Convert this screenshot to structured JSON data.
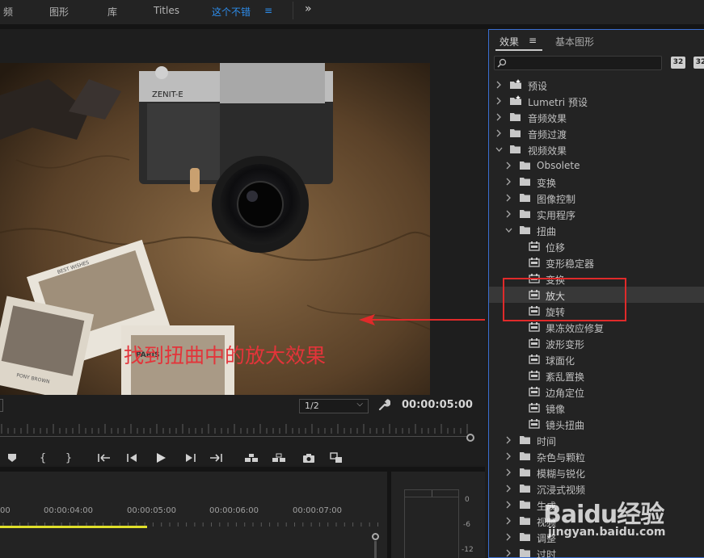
{
  "topbar": {
    "tabs": [
      {
        "label": "频",
        "active": false
      },
      {
        "label": "图形",
        "active": false
      },
      {
        "label": "库",
        "active": false
      },
      {
        "label": "Titles",
        "active": false
      },
      {
        "label": "这个不错",
        "active": true
      }
    ],
    "active_menu_icon": "hamburger-menu-icon",
    "overflow_label": "»"
  },
  "monitor": {
    "annotation_text": "找到扭曲中的放大效果",
    "resolution": "1/2",
    "timecode": "00:00:05:00",
    "camera_brand_label": "ZENIT-E",
    "photo_labels": [
      "PARIS",
      "BEST WISHES",
      "PONY BROWN"
    ],
    "transport_icons": [
      "marker-icon",
      "mark-in-icon",
      "mark-out-icon",
      "go-to-in-icon",
      "step-back-icon",
      "play-icon",
      "step-forward-icon",
      "go-to-out-icon",
      "lift-icon",
      "extract-icon",
      "export-frame-icon",
      "compare-icon"
    ],
    "add_label": "+"
  },
  "timeline": {
    "times": [
      "00",
      "00:00:04:00",
      "00:00:05:00",
      "00:00:06:00",
      "00:00:07:00"
    ],
    "meter_db": [
      "0",
      "-6",
      "-12"
    ]
  },
  "effects": {
    "tab_effects": "效果",
    "tab_menu": "≡",
    "tab_graphics": "基本图形",
    "search_value": "",
    "tool_labels": [
      "32",
      "32"
    ],
    "tree": [
      {
        "label": "预设",
        "level": 0,
        "kind": "star-folder",
        "expanded": false
      },
      {
        "label": "Lumetri 预设",
        "level": 0,
        "kind": "star-folder",
        "expanded": false
      },
      {
        "label": "音频效果",
        "level": 0,
        "kind": "folder",
        "expanded": false
      },
      {
        "label": "音频过渡",
        "level": 0,
        "kind": "folder",
        "expanded": false
      },
      {
        "label": "视频效果",
        "level": 0,
        "kind": "folder",
        "expanded": true
      },
      {
        "label": "Obsolete",
        "level": 1,
        "kind": "folder",
        "expanded": false
      },
      {
        "label": "变换",
        "level": 1,
        "kind": "folder",
        "expanded": false
      },
      {
        "label": "图像控制",
        "level": 1,
        "kind": "folder",
        "expanded": false
      },
      {
        "label": "实用程序",
        "level": 1,
        "kind": "folder",
        "expanded": false
      },
      {
        "label": "扭曲",
        "level": 1,
        "kind": "folder",
        "expanded": true
      },
      {
        "label": "位移",
        "level": 2,
        "kind": "effect"
      },
      {
        "label": "变形稳定器",
        "level": 2,
        "kind": "effect"
      },
      {
        "label": "变换",
        "level": 2,
        "kind": "effect"
      },
      {
        "label": "放大",
        "level": 2,
        "kind": "effect",
        "highlighted": true
      },
      {
        "label": "旋转",
        "level": 2,
        "kind": "effect"
      },
      {
        "label": "果冻效应修复",
        "level": 2,
        "kind": "effect"
      },
      {
        "label": "波形变形",
        "level": 2,
        "kind": "effect"
      },
      {
        "label": "球面化",
        "level": 2,
        "kind": "effect"
      },
      {
        "label": "紊乱置换",
        "level": 2,
        "kind": "effect"
      },
      {
        "label": "边角定位",
        "level": 2,
        "kind": "effect"
      },
      {
        "label": "镜像",
        "level": 2,
        "kind": "effect"
      },
      {
        "label": "镜头扭曲",
        "level": 2,
        "kind": "effect"
      },
      {
        "label": "时间",
        "level": 1,
        "kind": "folder",
        "expanded": false
      },
      {
        "label": "杂色与颗粒",
        "level": 1,
        "kind": "folder",
        "expanded": false
      },
      {
        "label": "模糊与锐化",
        "level": 1,
        "kind": "folder",
        "expanded": false
      },
      {
        "label": "沉浸式视频",
        "level": 1,
        "kind": "folder",
        "expanded": false
      },
      {
        "label": "生成",
        "level": 1,
        "kind": "folder",
        "expanded": false
      },
      {
        "label": "视频",
        "level": 1,
        "kind": "folder",
        "expanded": false
      },
      {
        "label": "调整",
        "level": 1,
        "kind": "folder",
        "expanded": false
      },
      {
        "label": "过时",
        "level": 1,
        "kind": "folder",
        "expanded": false
      }
    ]
  },
  "watermark": {
    "logo": "Baidu经验",
    "url": "jingyan.baidu.com"
  },
  "colors": {
    "accent_blue": "#2d8ceb",
    "annotation_red": "#e3343a",
    "workarea_yellow": "#dede2a"
  }
}
